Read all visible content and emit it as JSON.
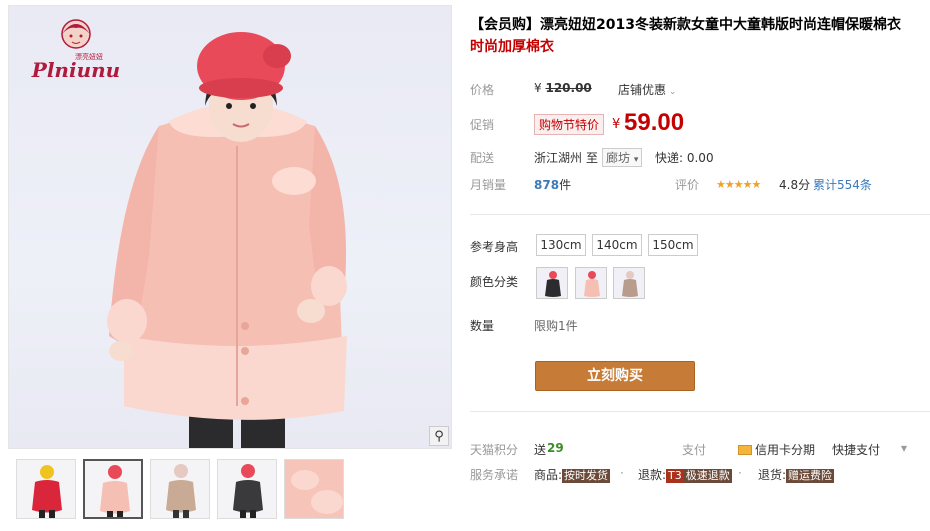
{
  "product": {
    "title_main": "【会员购】漂亮妞妞2013冬装新款女童中大童韩版时尚连帽保暖棉衣",
    "title_sub": "时尚加厚棉衣"
  },
  "brand": {
    "logo_text": "Plniunu",
    "logo_cn": "漂亮妞妞"
  },
  "price": {
    "label": "价格",
    "currency": "¥",
    "original": "120.00",
    "store_discount": "店铺优惠",
    "promo_label": "促销",
    "promo_tag": "购物节特价",
    "promo_price": "59.00"
  },
  "shipping": {
    "label": "配送",
    "from": "浙江湖州",
    "to_word": "至",
    "destination": "廊坊",
    "express": "快递: 0.00"
  },
  "sales": {
    "label": "月销量",
    "count": "878",
    "unit": "件",
    "rating_label": "评价",
    "stars": "★★★★★",
    "rating": "4.8分",
    "reviews": "累计554条"
  },
  "height": {
    "label": "参考身高",
    "options": [
      "130cm",
      "140cm",
      "150cm"
    ]
  },
  "color": {
    "label": "颜色分类"
  },
  "quantity": {
    "label": "数量",
    "limit": "限购1件"
  },
  "buy_button": "立刻购买",
  "points": {
    "label": "天猫积分",
    "send": "送",
    "value": "29"
  },
  "payment": {
    "pay_label": "支付",
    "credit": "信用卡分期",
    "quick": "快捷支付",
    "more": "▾"
  },
  "service": {
    "label": "服务承诺",
    "goods": "商品:",
    "goods_tag": "按时发货",
    "refund": "退款:",
    "refund_tag1": "T3",
    "refund_tag2": "极速退款",
    "return": "退货:",
    "return_tag": "赠运费险"
  },
  "colors": {
    "price_red": "#c40000",
    "buy_button": "#c67c36",
    "coat_pink": "#f6bfb4",
    "hat_red": "#e94a5a"
  },
  "icons": {
    "zoom": "magnifier-icon",
    "dropdown": "chevron-down-icon",
    "card": "credit-card-icon"
  }
}
